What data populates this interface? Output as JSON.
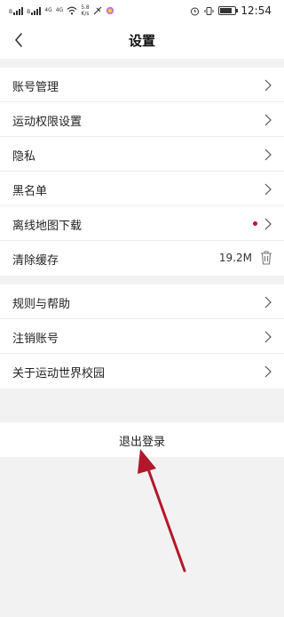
{
  "status_bar": {
    "sim1": "B",
    "sim2": "B",
    "net1": "4G",
    "net2": "4G",
    "speed_value": "5.8",
    "speed_unit": "K/s",
    "battery": "0.7",
    "time": "12:54"
  },
  "header": {
    "title": "设置"
  },
  "settings_group_1": [
    {
      "label": "账号管理"
    },
    {
      "label": "运动权限设置"
    },
    {
      "label": "隐私"
    },
    {
      "label": "黑名单"
    },
    {
      "label": "离线地图下载",
      "has_dot": true
    },
    {
      "label": "清除缓存",
      "value": "19.2M"
    }
  ],
  "settings_group_2": [
    {
      "label": "规则与帮助"
    },
    {
      "label": "注销账号"
    },
    {
      "label": "关于运动世界校园"
    }
  ],
  "logout_label": "退出登录",
  "colors": {
    "accent_red": "#c8102e",
    "arrow": "#b2182b"
  }
}
